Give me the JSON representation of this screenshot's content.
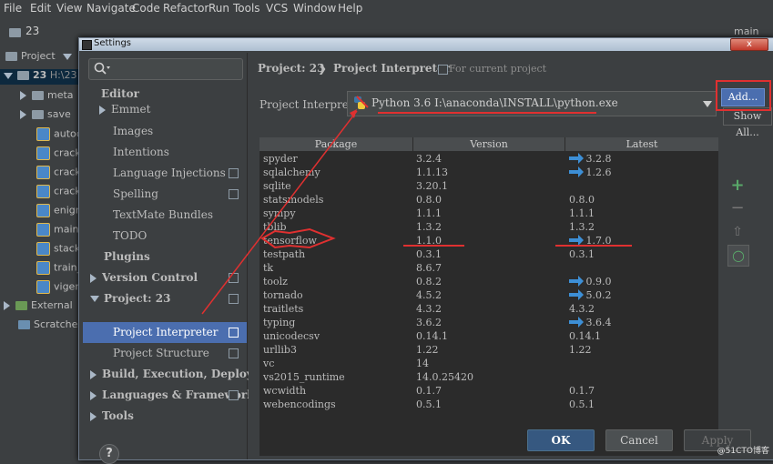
{
  "menubar": [
    "File",
    "Edit",
    "View",
    "Navigate",
    "Code",
    "Refactor",
    "Run",
    "Tools",
    "VCS",
    "Window",
    "Help"
  ],
  "toolbar": {
    "project_name": "23",
    "branch_label": "main"
  },
  "project_tree": {
    "header": "Project",
    "root": "23",
    "root_path": "H:\\23",
    "items": [
      "meta",
      "save",
      "autoc",
      "crack",
      "crack",
      "crack",
      "enigm",
      "main.",
      "stacke",
      "train_",
      "vigen"
    ],
    "external": "External",
    "scratches": "Scratches"
  },
  "dialog": {
    "title": "Settings",
    "close_label": "x",
    "search_placeholder": "",
    "nav": {
      "editor": "Editor",
      "emmet": "Emmet",
      "images": "Images",
      "intentions": "Intentions",
      "language_injections": "Language Injections",
      "spelling": "Spelling",
      "textmate": "TextMate Bundles",
      "todo": "TODO",
      "plugins": "Plugins",
      "version_control": "Version Control",
      "project": "Project: 23",
      "project_interpreter": "Project Interpreter",
      "project_structure": "Project Structure",
      "build": "Build, Execution, Deployment",
      "languages": "Languages & Frameworks",
      "tools": "Tools"
    },
    "breadcrumb": {
      "project": "Project: 23",
      "page": "Project Interpreter",
      "scope": "For current project"
    },
    "interpreter_label": "Project Interpreter:",
    "interpreter_value": "Python 3.6 I:\\anaconda\\INSTALL\\python.exe",
    "add_button": "Add...",
    "show_all": "Show All...",
    "table": {
      "columns": [
        "Package",
        "Version",
        "Latest"
      ],
      "rows": [
        {
          "package": "spyder",
          "version": "3.2.4",
          "latest": "3.2.8",
          "update": true
        },
        {
          "package": "sqlalchemy",
          "version": "1.1.13",
          "latest": "1.2.6",
          "update": true
        },
        {
          "package": "sqlite",
          "version": "3.20.1",
          "latest": "",
          "update": false
        },
        {
          "package": "statsmodels",
          "version": "0.8.0",
          "latest": "0.8.0",
          "update": false
        },
        {
          "package": "sympy",
          "version": "1.1.1",
          "latest": "1.1.1",
          "update": false
        },
        {
          "package": "tblib",
          "version": "1.3.2",
          "latest": "1.3.2",
          "update": false
        },
        {
          "package": "tensorflow",
          "version": "1.1.0",
          "latest": "1.7.0",
          "update": true
        },
        {
          "package": "testpath",
          "version": "0.3.1",
          "latest": "0.3.1",
          "update": false
        },
        {
          "package": "tk",
          "version": "8.6.7",
          "latest": "",
          "update": false
        },
        {
          "package": "toolz",
          "version": "0.8.2",
          "latest": "0.9.0",
          "update": true
        },
        {
          "package": "tornado",
          "version": "4.5.2",
          "latest": "5.0.2",
          "update": true
        },
        {
          "package": "traitlets",
          "version": "4.3.2",
          "latest": "4.3.2",
          "update": false
        },
        {
          "package": "typing",
          "version": "3.6.2",
          "latest": "3.6.4",
          "update": true
        },
        {
          "package": "unicodecsv",
          "version": "0.14.1",
          "latest": "0.14.1",
          "update": false
        },
        {
          "package": "urllib3",
          "version": "1.22",
          "latest": "1.22",
          "update": false
        },
        {
          "package": "vc",
          "version": "14",
          "latest": "",
          "update": false
        },
        {
          "package": "vs2015_runtime",
          "version": "14.0.25420",
          "latest": "",
          "update": false
        },
        {
          "package": "wcwidth",
          "version": "0.1.7",
          "latest": "0.1.7",
          "update": false
        },
        {
          "package": "webencodings",
          "version": "0.5.1",
          "latest": "0.5.1",
          "update": false
        }
      ]
    },
    "side_buttons": {
      "add": "+",
      "remove": "−",
      "upgrade": "⇧",
      "refresh": "○"
    },
    "buttons": {
      "ok": "OK",
      "cancel": "Cancel",
      "apply": "Apply"
    },
    "help": "?"
  },
  "watermark": "@51CTO博客",
  "colors": {
    "background": "#3c3f41",
    "selection": "#4b6eaf",
    "annotation": "#e03030",
    "update_arrow": "#3d8fd6"
  }
}
